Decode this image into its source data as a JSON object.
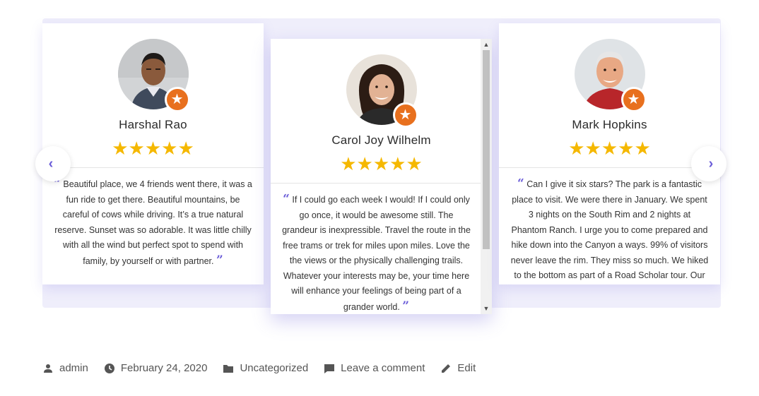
{
  "testimonials": [
    {
      "name": "Harshal Rao",
      "stars": "★★★★★",
      "quote": "Beautiful place, we 4 friends went there, it was a fun ride to get there. Beautiful mountains, be careful of cows while driving. It’s a true natural reserve. Sunset was so adorable. It was little chilly with all the wind but perfect spot to spend with family, by yourself or with partner.",
      "rating": 5
    },
    {
      "name": "Carol Joy Wilhelm",
      "stars": "★★★★★",
      "quote": "If I could go each week I would! If I could only go once, it would be awesome still. The grandeur is inexpressible. Travel the route in the free trams or trek for miles upon miles. Love the the views or the physically challenging trails. Whatever your interests may be, your time here will enhance your feelings of being part of a grander world.",
      "rating": 5
    },
    {
      "name": "Mark Hopkins",
      "stars": "★★★★★",
      "quote": "Can I give it six stars? The park is a fantastic place to visit. We were there in January. We spent 3 nights on the South Rim and 2 nights at Phantom Ranch. I urge you to come prepared and hike down into the Canyon a ways. 99% of visitors never leave the rim. They miss so much. We hiked to the bottom as part of a Road Scholar tour. Our",
      "rating": 5
    }
  ],
  "quote_open": "“",
  "quote_close": "”",
  "badge_icon": "star-badge-icon",
  "nav": {
    "prev": "‹",
    "next": "›"
  },
  "scroll": {
    "up": "▲",
    "down": "▼"
  },
  "meta": {
    "author": "admin",
    "date": "February 24, 2020",
    "category": "Uncategorized",
    "comment": "Leave a comment",
    "edit": "Edit"
  },
  "colors": {
    "accent": "#6a5cd8",
    "star": "#f5b800",
    "badge": "#e8701e"
  }
}
